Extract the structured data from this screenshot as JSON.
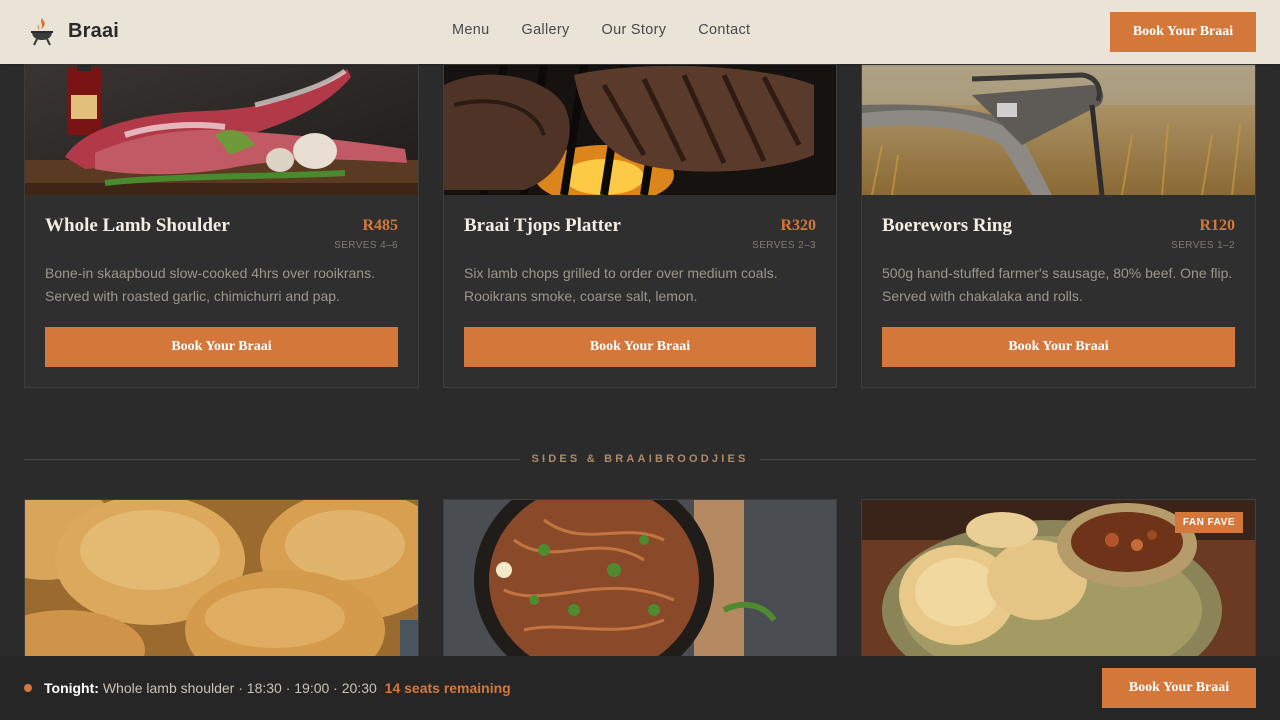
{
  "header": {
    "brand": "Braai",
    "logo_icon": "braai-grill-icon",
    "nav": [
      "Menu",
      "Gallery",
      "Our Story",
      "Contact"
    ],
    "cta_label": "Book Your Braai"
  },
  "cards": [
    {
      "title": "Whole Lamb Shoulder",
      "price": "R485",
      "serves": "SERVES 4–6",
      "description": "Bone-in skaapboud slow-cooked 4hrs over rooikrans. Served with roasted garlic, chimichurri and pap.",
      "button": "Book Your Braai"
    },
    {
      "title": "Braai Tjops Platter",
      "price": "R320",
      "serves": "SERVES 2–3",
      "description": "Six lamb chops grilled to order over medium coals. Rooikrans smoke, coarse salt, lemon.",
      "button": "Book Your Braai"
    },
    {
      "title": "Boerewors Ring",
      "price": "R120",
      "serves": "SERVES 1–2",
      "description": "500g hand-stuffed farmer's sausage, 80% beef. One flip. Served with chakalaka and rolls.",
      "button": "Book Your Braai"
    }
  ],
  "sides": {
    "heading": "SIDES & BRAAIBROODJIES",
    "tiles": [
      {
        "badge": ""
      },
      {
        "badge": ""
      },
      {
        "badge": "FAN FAVE"
      }
    ]
  },
  "bottom_bar": {
    "label": "Tonight:",
    "details": "Whole lamb shoulder · 18:30 · 19:00 · 20:30",
    "seats": "14 seats remaining",
    "cta_label": "Book Your Braai"
  },
  "colors": {
    "accent": "#d4773b",
    "background": "#2b2b2b",
    "header_bg": "#f1eade"
  }
}
